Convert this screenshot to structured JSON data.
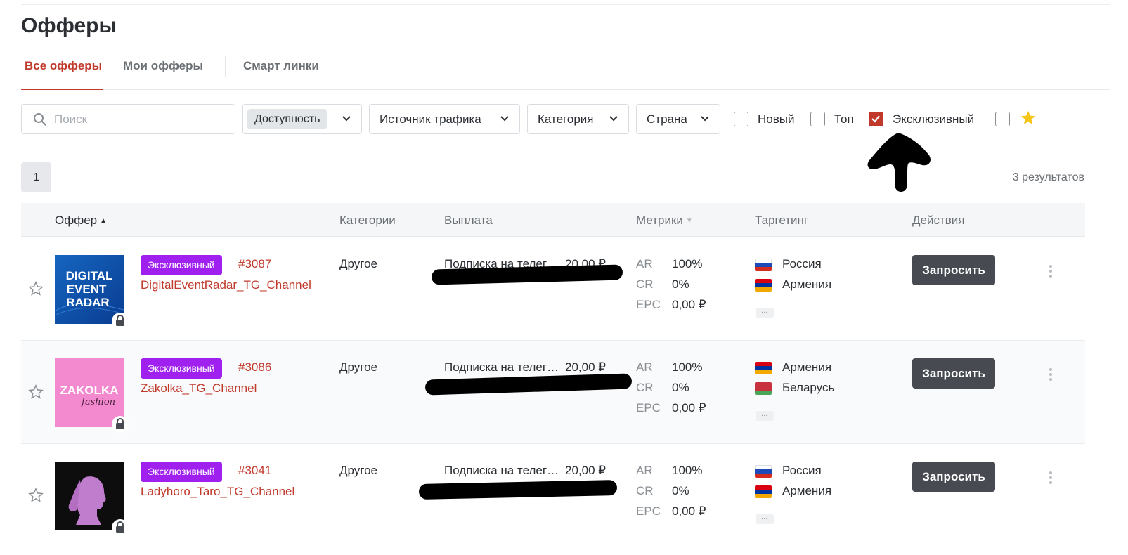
{
  "page": {
    "title": "Офферы"
  },
  "tabs": [
    {
      "label": "Все офферы",
      "active": true
    },
    {
      "label": "Мои офферы",
      "active": false
    },
    {
      "label": "Смарт линки",
      "active": false
    }
  ],
  "filters": {
    "search_placeholder": "Поиск",
    "availability_label": "Доступность",
    "traffic_source_label": "Источник трафика",
    "category_label": "Категория",
    "country_label": "Страна",
    "checkboxes": [
      {
        "label": "Новый",
        "checked": false
      },
      {
        "label": "Топ",
        "checked": false
      },
      {
        "label": "Эксклюзивный",
        "checked": true
      },
      {
        "icon": "star-icon",
        "checked": false
      }
    ]
  },
  "pagination": {
    "current_page": "1",
    "results_text": "3  результатов"
  },
  "table": {
    "headers": [
      "Оффер",
      "Категории",
      "Выплата",
      "Метрики",
      "Таргетинг",
      "Действия"
    ],
    "rows": [
      {
        "badge": "Эксклюзивный",
        "id": "#3087",
        "name": "DigitalEventRadar_TG_Channel",
        "category": "Другое",
        "payout_name": "Подписка на телеграм канал",
        "payout_amount": "20,00 ₽",
        "metrics": [
          {
            "label": "AR",
            "value": "100%"
          },
          {
            "label": "CR",
            "value": "0%"
          },
          {
            "label": "EPC",
            "value": "0,00 ₽"
          }
        ],
        "targeting": [
          "Россия",
          "Армения"
        ],
        "action_label": "Запросить"
      },
      {
        "badge": "Эксклюзивный",
        "id": "#3086",
        "name": "Zakolka_TG_Channel",
        "category": "Другое",
        "payout_name": "Подписка на телеграм канал",
        "payout_amount": "20,00 ₽",
        "metrics": [
          {
            "label": "AR",
            "value": "100%"
          },
          {
            "label": "CR",
            "value": "0%"
          },
          {
            "label": "EPC",
            "value": "0,00 ₽"
          }
        ],
        "targeting": [
          "Армения",
          "Беларусь"
        ],
        "action_label": "Запросить"
      },
      {
        "badge": "Эксклюзивный",
        "id": "#3041",
        "name": "Ladyhoro_Taro_TG_Channel",
        "category": "Другое",
        "payout_name": "Подписка на телеграм канал",
        "payout_amount": "20,00 ₽",
        "metrics": [
          {
            "label": "AR",
            "value": "100%"
          },
          {
            "label": "CR",
            "value": "0%"
          },
          {
            "label": "EPC",
            "value": "0,00 ₽"
          }
        ],
        "targeting": [
          "Россия",
          "Армения"
        ],
        "action_label": "Запросить"
      }
    ]
  },
  "logos": {
    "digital_event_radar": [
      "DIGITAL",
      "EVENT",
      "RADAR"
    ],
    "zakolka": [
      "ZAKOLKA",
      "fashion"
    ]
  },
  "colors": {
    "accent": "#c0392b",
    "badge": "#a020f0",
    "button": "#474b51",
    "star_filled": "#f5c518"
  }
}
